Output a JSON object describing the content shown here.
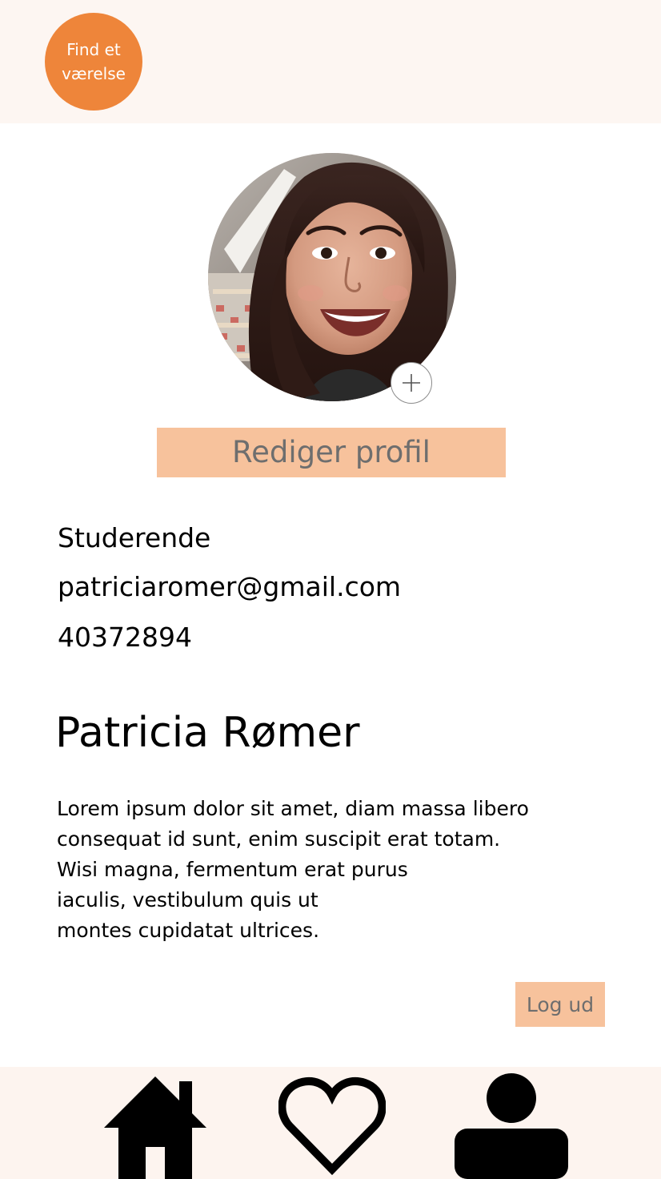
{
  "header": {
    "find_room_line1": "Find et",
    "find_room_line2": "værelse",
    "accent_color": "#ee853a",
    "background_color": "#fdf6f2"
  },
  "profile": {
    "avatar_icon": "profile-photo",
    "add_photo_icon": "plus-icon",
    "edit_button_label": "Rediger profil",
    "role": "Studerende",
    "email": "patriciaromer@gmail.com",
    "phone": "40372894",
    "name": "Patricia Rømer",
    "bio_lines": [
      "Lorem ipsum dolor sit amet, diam massa libero",
      "consequat id sunt, enim suscipit erat totam.",
      "Wisi magna, fermentum erat purus",
      "iaculis, vestibulum quis ut",
      "montes cupidatat ultrices."
    ],
    "button_color": "#f7c29c",
    "logout_label": "Log ud"
  },
  "bottom_nav": {
    "items": [
      {
        "icon": "home-icon"
      },
      {
        "icon": "heart-icon"
      },
      {
        "icon": "user-icon"
      }
    ],
    "background_color": "#fdf4ef"
  }
}
